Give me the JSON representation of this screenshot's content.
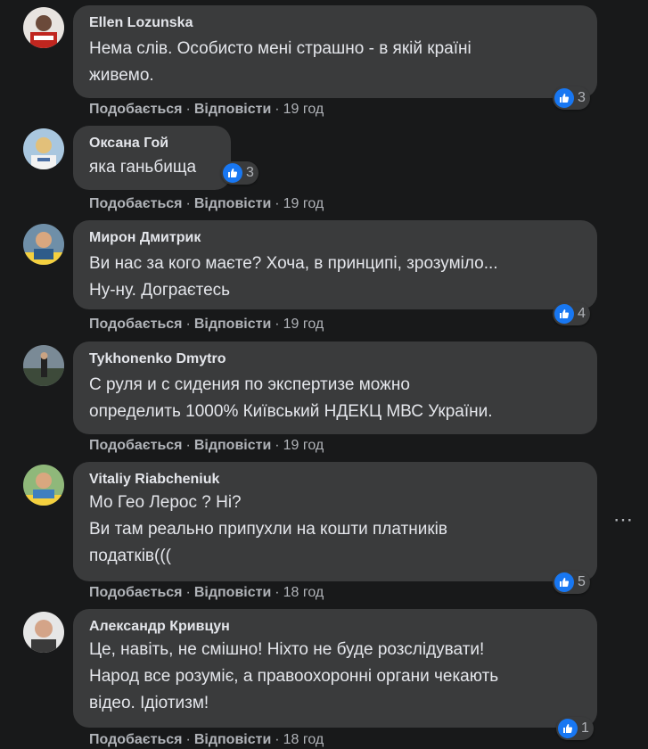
{
  "labels": {
    "like": "Подобається",
    "reply": "Відповісти",
    "separator": "·"
  },
  "more_icon": "⋯",
  "comments": [
    {
      "author": "Ellen Lozunska",
      "text": "Нема слів. Особисто мені страшно - в якій країні\nживемо.",
      "reactions": "3",
      "time": "19 год"
    },
    {
      "author": "Оксана Гой",
      "text": "яка ганьбища",
      "reactions": "3",
      "time": "19 год"
    },
    {
      "author": "Мирон Дмитрик",
      "text": "Ви нас за кого маєте? Хоча, в принципі, зрозуміло...\nНу-ну. Дограєтесь",
      "reactions": "4",
      "time": "19 год"
    },
    {
      "author": "Tykhonenko Dmytro",
      "text": "С руля и с сидения по экспертизе можно\nопределить 1000% Київський НДЕКЦ МВС України.",
      "reactions": "",
      "time": "19 год"
    },
    {
      "author": "Vitaliy Riabcheniuk",
      "text": "Мо Гео Лерос ? Ні?\nВи там реально припухли на кошти платників\nподатків(((",
      "reactions": "5",
      "time": "18 год"
    },
    {
      "author": "Александр Кривцун",
      "text": "Це, навіть, не смішно! Ніхто не буде розслідувати!\nНарод все розуміє, а правоохоронні органи чекають\nвідео. Ідіотизм!",
      "reactions": "1",
      "time": "18 год"
    }
  ],
  "colors": {
    "background": "#18191a",
    "bubble": "#3a3b3c",
    "text": "#e4e6eb",
    "secondary": "#b0b3b8",
    "like_blue": "#1877f2"
  },
  "icons": {
    "reaction": "thumbs-up-icon",
    "more": "more-options-icon"
  }
}
